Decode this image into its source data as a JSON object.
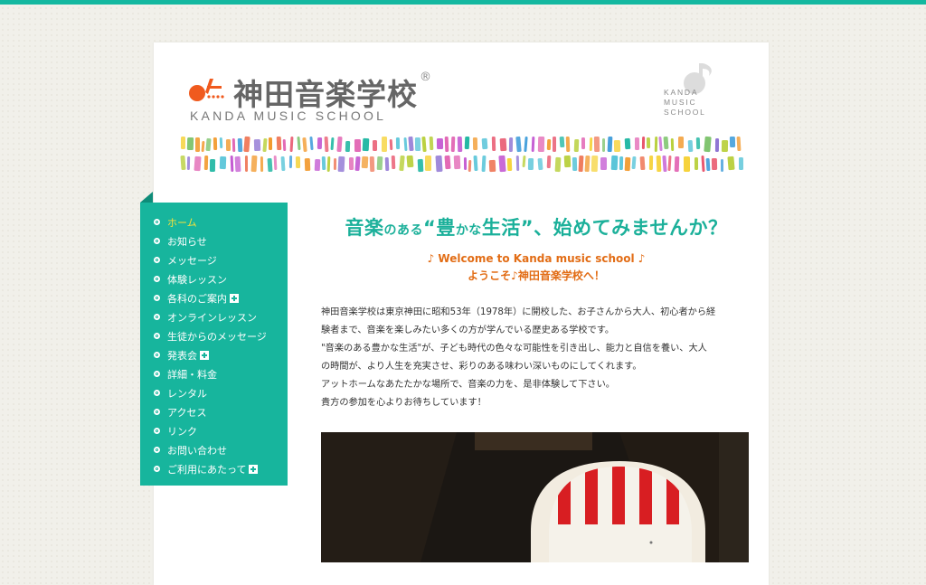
{
  "brand": {
    "title": "神田音楽学校",
    "registered": "®",
    "subtitle": "KANDA MUSIC SCHOOL",
    "badge_lines": [
      "KANDA",
      "MUSIC",
      "SCHOOL"
    ],
    "accent_color": "#14b8a0",
    "logo_color": "#f05a1e"
  },
  "nav": {
    "items": [
      {
        "label": "ホーム",
        "active": true,
        "expandable": false
      },
      {
        "label": "お知らせ",
        "active": false,
        "expandable": false
      },
      {
        "label": "メッセージ",
        "active": false,
        "expandable": false
      },
      {
        "label": "体験レッスン",
        "active": false,
        "expandable": false
      },
      {
        "label": "各科のご案内",
        "active": false,
        "expandable": true
      },
      {
        "label": "オンラインレッスン",
        "active": false,
        "expandable": false
      },
      {
        "label": "生徒からのメッセージ",
        "active": false,
        "expandable": false
      },
      {
        "label": "発表会",
        "active": false,
        "expandable": true
      },
      {
        "label": "詳細・料金",
        "active": false,
        "expandable": false
      },
      {
        "label": "レンタル",
        "active": false,
        "expandable": false
      },
      {
        "label": "アクセス",
        "active": false,
        "expandable": false
      },
      {
        "label": "リンク",
        "active": false,
        "expandable": false
      },
      {
        "label": "お問い合わせ",
        "active": false,
        "expandable": false
      },
      {
        "label": "ご利用にあたって",
        "active": false,
        "expandable": true
      }
    ]
  },
  "main": {
    "headline_a": "音楽",
    "headline_b": "のある",
    "headline_c": "“豊",
    "headline_d": "かな",
    "headline_e": "生活”、始めてみませんか？",
    "welcome_en": "♪ Welcome to Kanda music school ♪",
    "welcome_jp": "ようこそ♪神田音楽学校へ！",
    "paragraph": [
      "神田音楽学校は東京神田に昭和53年（1978年）に開校した、お子さんから大人、初心者から経",
      "験者まで、音楽を楽しみたい多くの方が学んでいる歴史ある学校です。",
      "\"音楽のある豊かな生活\"が、子ども時代の色々な可能性を引き出し、能力と自信を養い、大人",
      "の時間が、より人生を充実させ、彩りのある味わい深いものにしてくれます。",
      "アットホームなあたたかな場所で、音楽の力を、是非体験して下さい。",
      "貴方の参加を心よりお待ちしています！"
    ]
  }
}
